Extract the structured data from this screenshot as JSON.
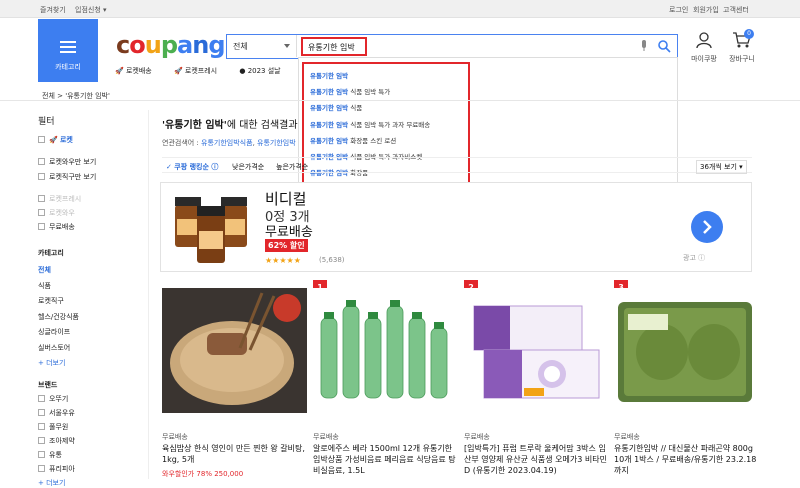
{
  "topbar": {
    "bookmark": "즐겨찾기",
    "seller": "입점신청 ▾",
    "login": "로그인",
    "signup": "회원가입",
    "support": "고객센터"
  },
  "category_button": {
    "label": "카테고리"
  },
  "logo": {
    "text": "coupang",
    "colors": [
      "#7a3b1e",
      "#e2262b",
      "#f2a316",
      "#4caf50",
      "#3d7ef0",
      "#2a6bd8",
      "#3d7ef0"
    ]
  },
  "search": {
    "category": "전체",
    "query": "유통기한 임박"
  },
  "header_icons": {
    "mypage": "마이쿠팡",
    "cart": "장바구니",
    "cart_count": "0"
  },
  "shortcuts": [
    "로켓배송",
    "로켓프레시",
    "2023 설날",
    "biz"
  ],
  "dropdown": {
    "prefix": "유통기한 임박",
    "items": [
      "",
      " 식품 임박 특가",
      " 식품",
      " 식품 임박 특가 과자 무료배송",
      " 화장품 스킨 로션",
      " 식품 임박 특가 과자비스켓",
      " 화장품",
      " 라면",
      " 사료",
      " 두유"
    ]
  },
  "breadcrumb": "전체 > '유통기한 임박'",
  "result": {
    "query": "'유통기한 임박'",
    "suffix": "에 대한 검색결과"
  },
  "related": {
    "label": "연관검색어 :",
    "terms": [
      "유통기한임박식품",
      "유통기한임박"
    ]
  },
  "sort": {
    "rank": "✓ 쿠팡 랭킹순 ⓘ",
    "low": "낮은가격순",
    "high": "높은가격순",
    "per_page": "36개씩 보기 ▾"
  },
  "sidebar": {
    "filter": "필터",
    "rocket": "로켓",
    "rocket_wow": "로켓와우만 보기",
    "rocket_direct": "로켓직구만 보기",
    "rocket_fresh": "로켓프레시",
    "rocket_wow2": "로켓와우",
    "free_ship": "무료배송",
    "category_title": "카테고리",
    "categories": [
      "전체",
      "식품",
      "로켓직구",
      "헬스/건강식품",
      "싱글라이프",
      "실버스토어",
      "+ 더보기"
    ],
    "brand_title": "브랜드",
    "brands": [
      "오뚜기",
      "서울우유",
      "풀무원",
      "조아제약",
      "유통",
      "퓨리피아",
      "+ 더보기"
    ]
  },
  "ad": {
    "title": "비디컬",
    "line2": "0정 3개",
    "line3": "무료배송",
    "discount": "62% 할인",
    "stars": "★★★★★",
    "reviews": "(5,638)",
    "label": "광고 ⓘ"
  },
  "products": [
    {
      "rank": "",
      "ship": "무료배송",
      "name": "육심밥상 한식 영인이 만든 찐한 왕 갈비탕, 1kg, 5개",
      "price": "와우할인가 78% 250,000"
    },
    {
      "rank": "1",
      "ship": "무료배송",
      "name": "알로에주스 베라 1500ml 12개 유통기한 임박상품 가성비음료 페리음료 식당음료 탕비실음료, 1.5L",
      "price": ""
    },
    {
      "rank": "2",
      "ship": "무료배송",
      "name": "[임박특가] 퓨럽 트루락 울케어맘 3박스 임산부 영양제 유산균 식품생 오메가3 비타민D (유통기한 2023.04.19)",
      "price": ""
    },
    {
      "rank": "3",
      "ship": "무료배송",
      "name": "유통기한임박 // 대신물산 파래곤약 800g 10개 1박스 / 무료배송/유통기한 23.2.18까지",
      "price": ""
    }
  ],
  "colors": {
    "accent": "#3d7ef0",
    "red": "#e2262b",
    "link": "#2a6bd8"
  }
}
